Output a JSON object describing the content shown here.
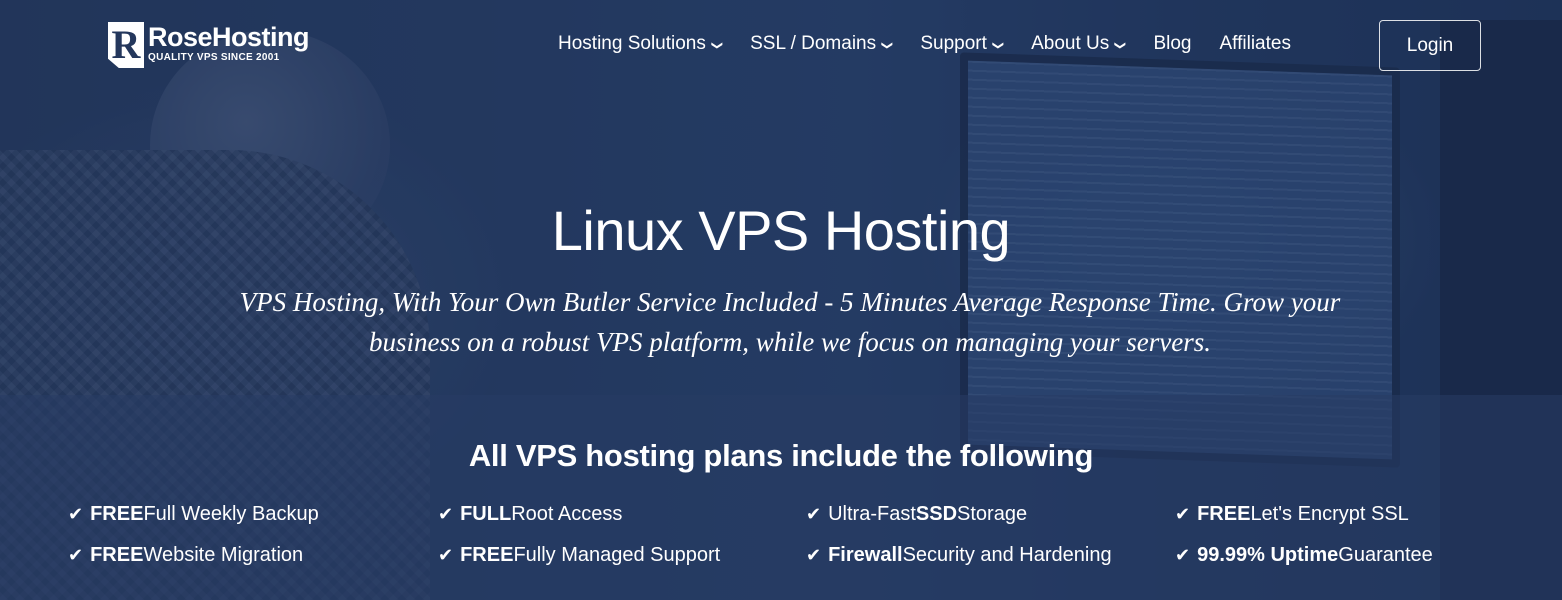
{
  "brand": {
    "logo_letter": "R",
    "name": "RoseHosting",
    "tagline": "QUALITY VPS SINCE 2001"
  },
  "nav": {
    "items": [
      {
        "label": "Hosting Solutions",
        "dropdown": true
      },
      {
        "label": "SSL / Domains",
        "dropdown": true
      },
      {
        "label": "Support",
        "dropdown": true
      },
      {
        "label": "About Us",
        "dropdown": true
      },
      {
        "label": "Blog",
        "dropdown": false
      },
      {
        "label": "Affiliates",
        "dropdown": false
      }
    ],
    "login_label": "Login"
  },
  "hero": {
    "title": "Linux VPS Hosting",
    "subtitle_line1": "VPS Hosting, With Your Own Butler Service Included - 5 Minutes Average Response Time. Grow your",
    "subtitle_line2": "business on a robust VPS platform, while we focus on managing your servers."
  },
  "features": {
    "title": "All VPS hosting plans include the following",
    "items": [
      {
        "bold": "FREE",
        "text": " Full Weekly Backup"
      },
      {
        "bold": "FULL",
        "text": " Root Access"
      },
      {
        "pre": "Ultra-Fast ",
        "bold": "SSD",
        "text": " Storage"
      },
      {
        "bold": "FREE",
        "text": " Let's Encrypt SSL"
      },
      {
        "bold": "FREE",
        "text": " Website Migration"
      },
      {
        "bold": "FREE",
        "text": " Fully Managed Support"
      },
      {
        "bold": "Firewall",
        "text": " Security and Hardening"
      },
      {
        "bold": "99.99% Uptime",
        "text": " Guarantee"
      }
    ]
  },
  "icons": {
    "check": "check-icon",
    "chevron": "chevron-down-icon"
  }
}
